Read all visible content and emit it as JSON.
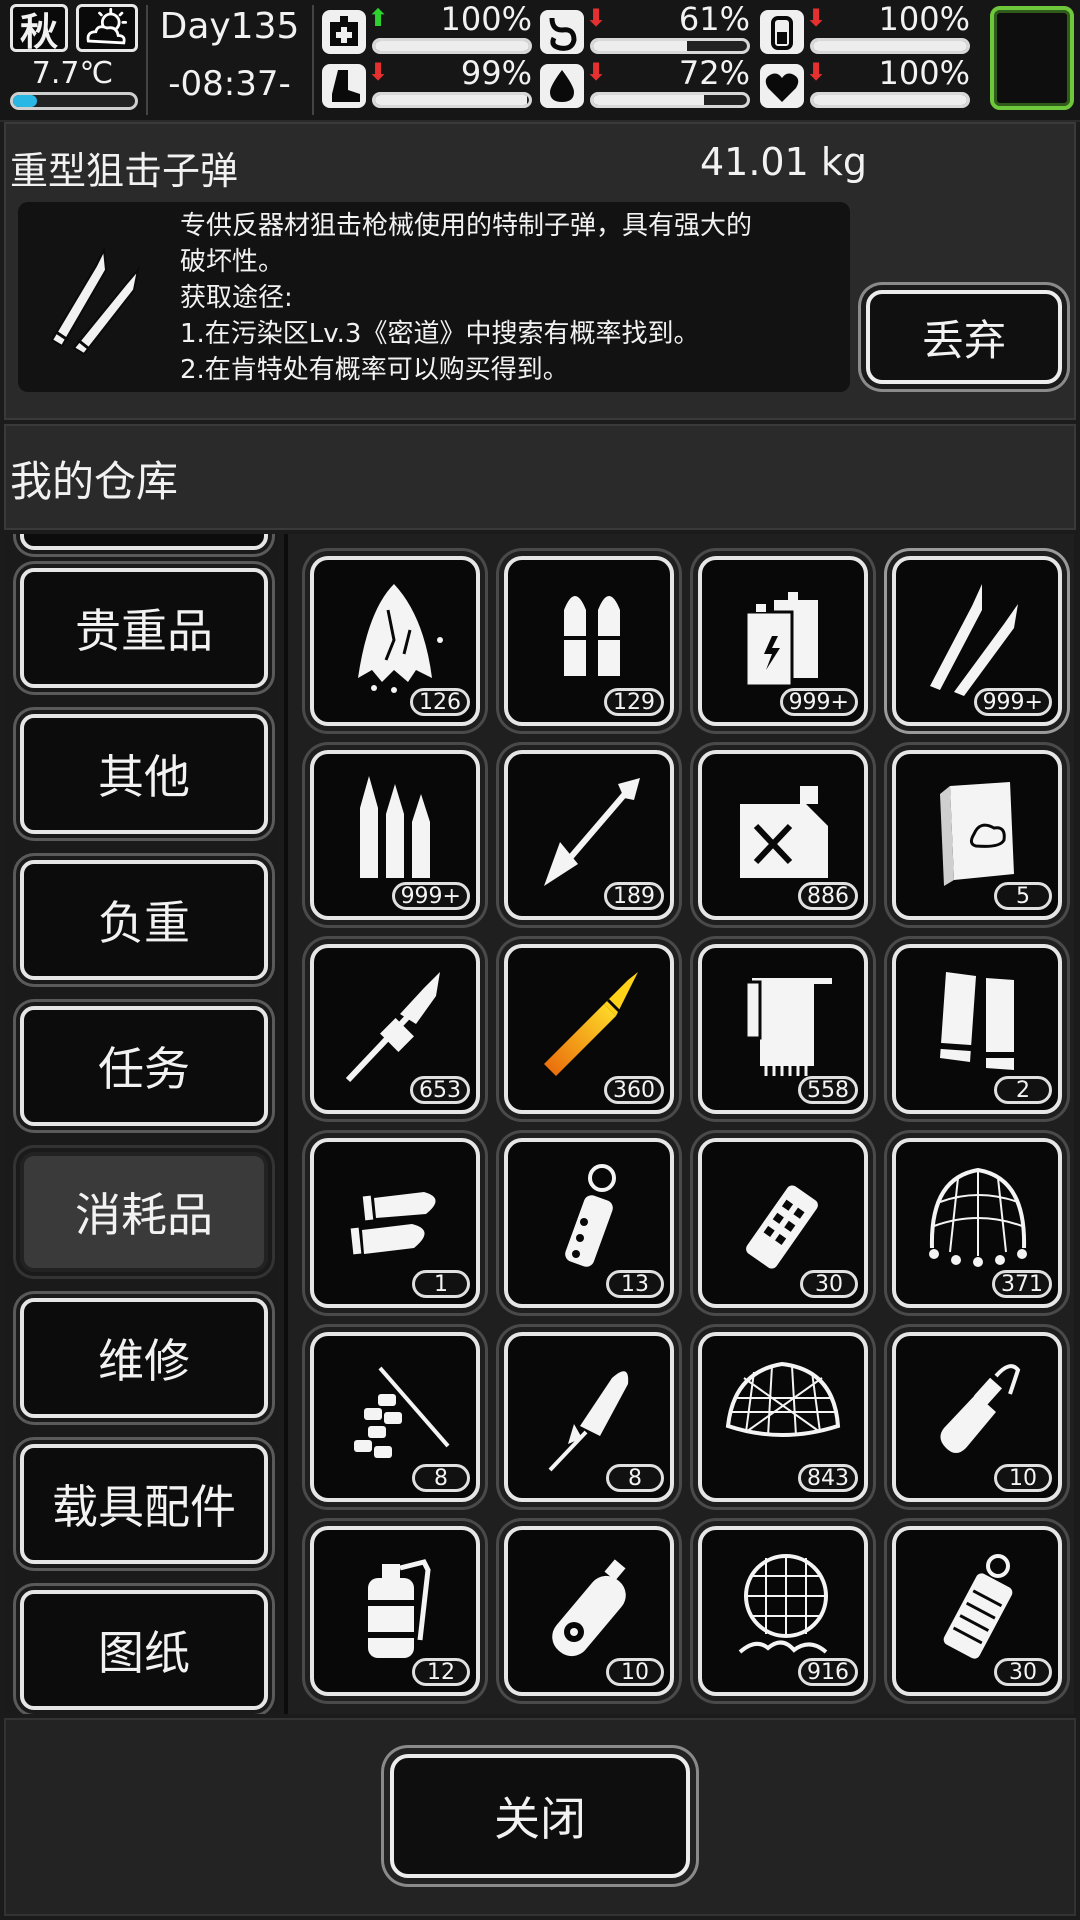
{
  "hud": {
    "season": "秋",
    "weather_icon": "partly-sunny-icon",
    "temperature": "7.7℃",
    "temperature_level": 0.2,
    "day": "Day135",
    "time": "-08:37-",
    "stats": [
      {
        "name": "health",
        "icon": "medkit-icon",
        "trend": "up",
        "value": "100%",
        "level": 1.0
      },
      {
        "name": "hunger",
        "icon": "stomach-icon",
        "trend": "down",
        "value": "61%",
        "level": 0.61
      },
      {
        "name": "energy",
        "icon": "battery-icon",
        "trend": "down",
        "value": "100%",
        "level": 1.0
      },
      {
        "name": "stamina",
        "icon": "boot-icon",
        "trend": "down",
        "value": "99%",
        "level": 0.99
      },
      {
        "name": "thirst",
        "icon": "water-drop-icon",
        "trend": "down",
        "value": "72%",
        "level": 0.72
      },
      {
        "name": "mood",
        "icon": "heart-icon",
        "trend": "down",
        "value": "100%",
        "level": 1.0
      }
    ],
    "colors": {
      "up": "#2fd12f",
      "down": "#e53030",
      "slot_border": "#6fc83c",
      "temp_fill": "#29b8e6"
    }
  },
  "item": {
    "name": "重型狙击子弹",
    "weight": "41.01 kg",
    "description_lines": [
      "专供反器材狙击枪械使用的特制子弹，具有强大的",
      "破坏性。",
      "获取途径:",
      "1.在污染区Lv.3《密道》中搜索有概率找到。",
      "2.在肯特处有概率可以购买得到。"
    ],
    "discard_label": "丢弃"
  },
  "warehouse": {
    "title": "我的仓库",
    "categories": [
      {
        "label": "贵重品",
        "active": false
      },
      {
        "label": "其他",
        "active": false
      },
      {
        "label": "负重",
        "active": false
      },
      {
        "label": "任务",
        "active": false
      },
      {
        "label": "消耗品",
        "active": true
      },
      {
        "label": "维修",
        "active": false
      },
      {
        "label": "载具配件",
        "active": false
      },
      {
        "label": "图纸",
        "active": false
      }
    ],
    "items": [
      {
        "icon": "torn-cloth-icon",
        "count": "126"
      },
      {
        "icon": "pistol-bullets-icon",
        "count": "129"
      },
      {
        "icon": "batteries-icon",
        "count": "999+"
      },
      {
        "icon": "sniper-bullets-icon",
        "count": "999+",
        "selected": true
      },
      {
        "icon": "rifle-bullets-icon",
        "count": "999+"
      },
      {
        "icon": "arrow-icon",
        "count": "189"
      },
      {
        "icon": "fuel-canister-icon",
        "count": "886"
      },
      {
        "icon": "book-icon",
        "count": "5"
      },
      {
        "icon": "rpg-rocket-icon",
        "count": "653"
      },
      {
        "icon": "golden-rocket-icon",
        "count": "360"
      },
      {
        "icon": "towel-icon",
        "count": "558"
      },
      {
        "icon": "shotgun-shells-icon",
        "count": "2"
      },
      {
        "icon": "large-bullets-icon",
        "count": "1"
      },
      {
        "icon": "flashbang-icon",
        "count": "13"
      },
      {
        "icon": "stun-grenade-icon",
        "count": "30"
      },
      {
        "icon": "net-icon",
        "count": "371"
      },
      {
        "icon": "firecrackers-icon",
        "count": "8"
      },
      {
        "icon": "firework-rocket-icon",
        "count": "8"
      },
      {
        "icon": "fishing-net-icon",
        "count": "843"
      },
      {
        "icon": "molotov-icon",
        "count": "10"
      },
      {
        "icon": "fire-extinguisher-grenade-icon",
        "count": "12"
      },
      {
        "icon": "gas-canister-icon",
        "count": "10"
      },
      {
        "icon": "trap-net-icon",
        "count": "916"
      },
      {
        "icon": "smoke-grenade-icon",
        "count": "30"
      }
    ]
  },
  "footer": {
    "close_label": "关闭"
  }
}
